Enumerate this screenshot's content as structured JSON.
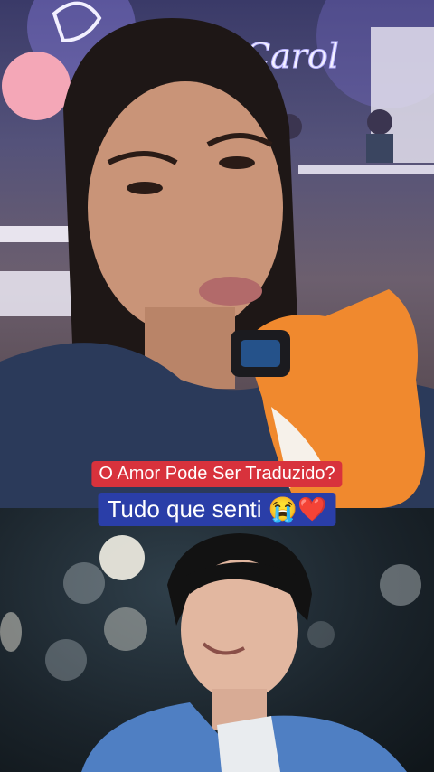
{
  "captions": {
    "title": "O Amor Pode Ser Traduzido?",
    "subtitle": "Tudo que senti",
    "subtitle_emoji_1": "😭",
    "subtitle_emoji_2": "❤️"
  },
  "background_text": {
    "neon_sign": "Carol"
  },
  "colors": {
    "caption_title_bg": "#d8323c",
    "caption_subtitle_bg": "#2a3ea8",
    "neon": "#e8eaff"
  }
}
